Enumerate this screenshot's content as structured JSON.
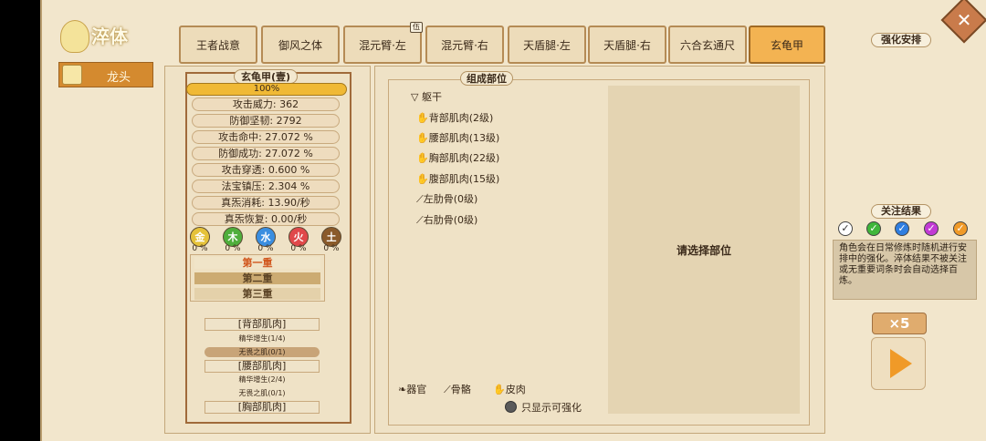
{
  "header": {
    "title": "淬体",
    "character": "龙头"
  },
  "tabs": [
    {
      "label": "王者战意",
      "badge": ""
    },
    {
      "label": "御风之体",
      "badge": ""
    },
    {
      "label": "混元臂·左",
      "badge": "伍"
    },
    {
      "label": "混元臂·右",
      "badge": ""
    },
    {
      "label": "天盾腿·左",
      "badge": ""
    },
    {
      "label": "天盾腿·右",
      "badge": ""
    },
    {
      "label": "六合玄通尺",
      "badge": ""
    },
    {
      "label": "玄龟甲",
      "badge": ""
    }
  ],
  "left": {
    "header": "玄龟甲(壹)",
    "progress": "100%",
    "stats": [
      "攻击威力: 362",
      "防御坚韧: 2792",
      "攻击命中: 27.072 %",
      "防御成功: 27.072 %",
      "攻击穿透: 0.600 %",
      "法宝镇压: 2.304 %",
      "真炁消耗: 13.90/秒",
      "真炁恢复: 0.00/秒"
    ],
    "elements": [
      {
        "label": "金",
        "pct": "0 %",
        "color": "#e5c23a"
      },
      {
        "label": "木",
        "pct": "0 %",
        "color": "#4fae3c"
      },
      {
        "label": "水",
        "pct": "0 %",
        "color": "#3a8ee0"
      },
      {
        "label": "火",
        "pct": "0 %",
        "color": "#e0484a"
      },
      {
        "label": "土",
        "pct": "0 %",
        "color": "#8a5a2a"
      }
    ],
    "layers": [
      "第一重",
      "第二重",
      "第三重"
    ],
    "rows": [
      {
        "header": "[背部肌肉]",
        "subs": [
          "精华增生(1/4)",
          "无畏之肌(0/1)"
        ]
      },
      {
        "header": "[腰部肌肉]",
        "subs": [
          "精华增生(2/4)",
          "无畏之肌(0/1)"
        ]
      },
      {
        "header": "[胸部肌肉]",
        "subs": []
      }
    ]
  },
  "middle": {
    "header": "组成部位",
    "group": "躯干",
    "parts": [
      "背部肌肉(2级)",
      "腰部肌肉(13级)",
      "胸部肌肉(22级)",
      "腹部肌肉(15级)",
      "左肋骨(0级)",
      "右肋骨(0级)"
    ],
    "detail_prompt": "请选择部位",
    "legend": [
      "器官",
      "骨骼",
      "皮肉"
    ],
    "toggle_label": "只显示可强化"
  },
  "right": {
    "arrange_header": "强化安排",
    "focus_header": "关注结果",
    "check_colors": [
      "#ffffff",
      "#3fb63a",
      "#2f7ee0",
      "#c23ad4",
      "#f09a28"
    ],
    "info": "角色会在日常修炼时随机进行安排中的强化。淬体结果不被关注或无重要词条时会自动选择百炼。",
    "multiplier": "×5"
  }
}
